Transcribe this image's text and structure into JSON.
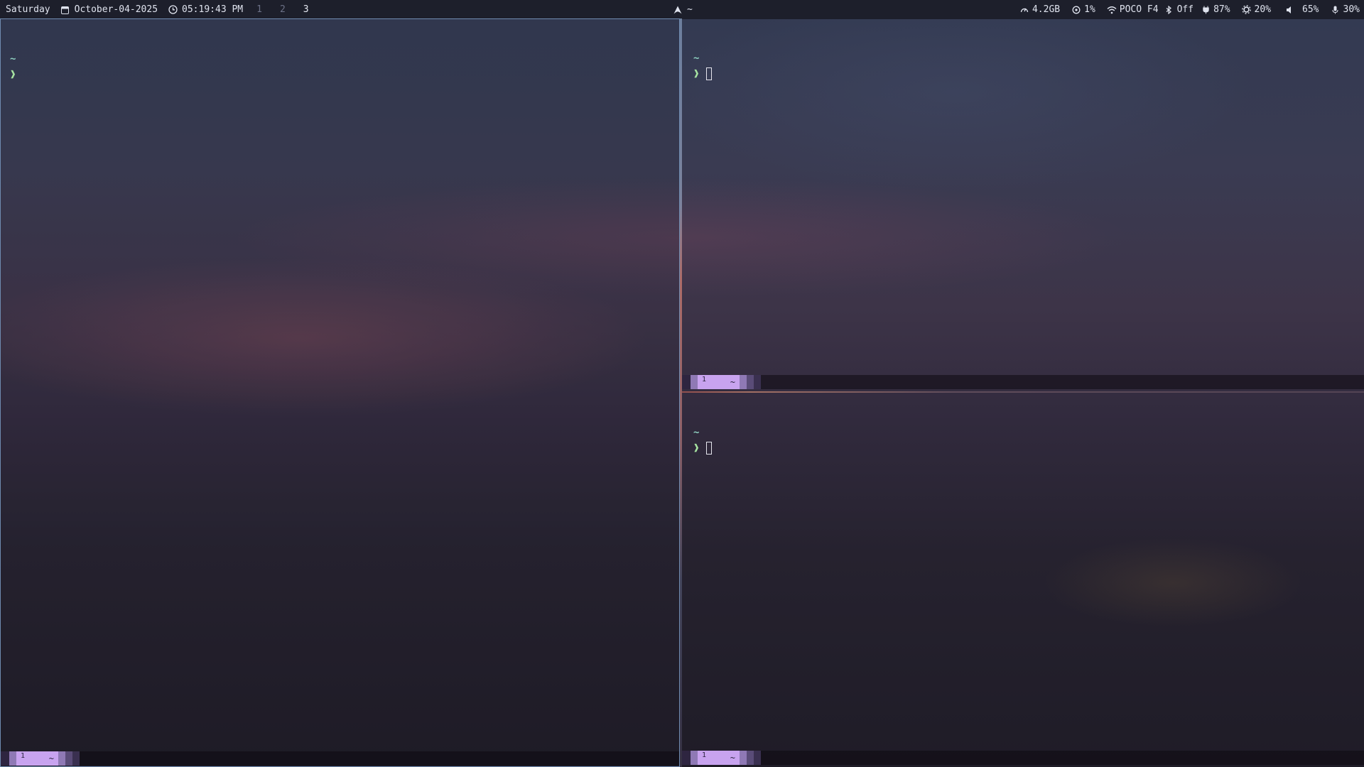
{
  "topbar": {
    "day": "Saturday",
    "date": "October-04-2025",
    "time": "05:19:43 PM",
    "workspaces": [
      "1",
      "2",
      "3"
    ],
    "active_workspace": "3",
    "center_title": "~",
    "memory": "4.2GB",
    "cpu": "1%",
    "wifi": "POCO F4",
    "bluetooth": "Off",
    "battery": "87%",
    "brightness": "20%",
    "volume": "65%",
    "mic": "30%",
    "icons": {
      "calendar": "calendar-icon",
      "clock": "clock-icon",
      "app": "arch-logo-icon",
      "memory": "memory-icon",
      "cpu": "cpu-icon",
      "wifi": "wifi-icon",
      "bluetooth": "bluetooth-icon",
      "battery": "battery-icon",
      "brightness": "brightness-icon",
      "volume": "volume-icon",
      "mic": "microphone-icon"
    }
  },
  "panes": [
    {
      "cwd": "~",
      "prompt_char": "❱",
      "status_tab_num": "1",
      "status_tab_label": "~"
    },
    {
      "cwd": "~",
      "prompt_char": "❱",
      "status_tab_num": "1",
      "status_tab_label": "~"
    },
    {
      "cwd": "~",
      "prompt_char": "❱",
      "status_tab_num": "1",
      "status_tab_label": "~"
    }
  ],
  "colors": {
    "accent": "#c8a3ef",
    "prompt_green": "#a6e3a1",
    "prompt_teal": "#8fd0c0",
    "bar_bg": "#1d1f2b"
  }
}
